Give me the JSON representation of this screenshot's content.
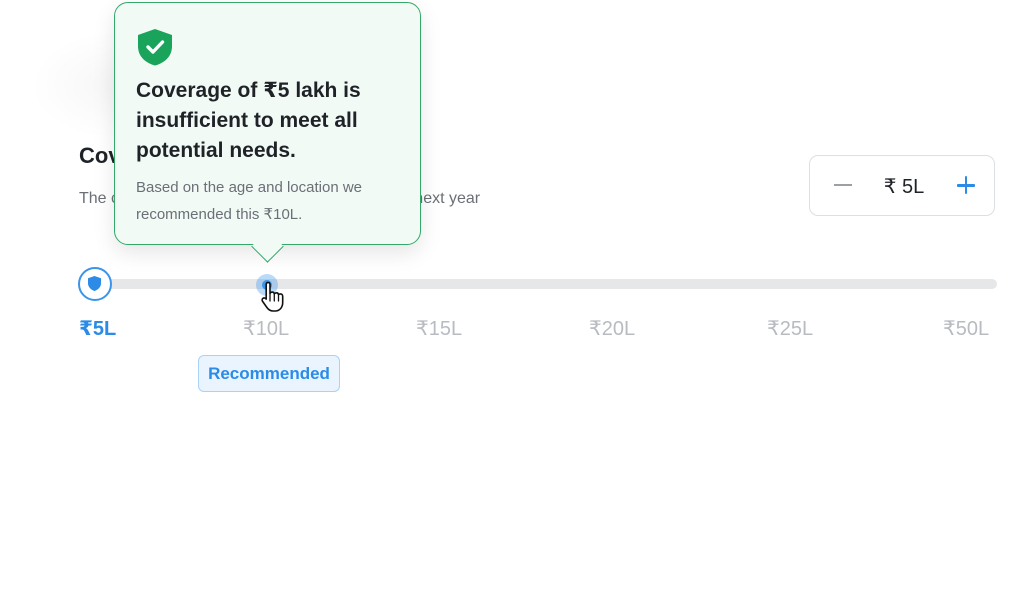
{
  "coverage": {
    "title": "Coverage (Family)",
    "description": "The coverage amount will be applicable for the next year"
  },
  "stepper": {
    "value": "₹ 5L"
  },
  "slider": {
    "selected": "₹5L",
    "ticks": [
      "₹5L",
      "₹10L",
      "₹15L",
      "₹20L",
      "₹25L",
      "₹50L"
    ],
    "recommended_label": "Recommended"
  },
  "tooltip": {
    "title": "Coverage of ₹5 lakh is insufficient to meet all potential needs.",
    "body": "Based on the age and location we recommended this ₹10L."
  },
  "colors": {
    "accent": "#2b8be6",
    "success": "#34a86a"
  }
}
